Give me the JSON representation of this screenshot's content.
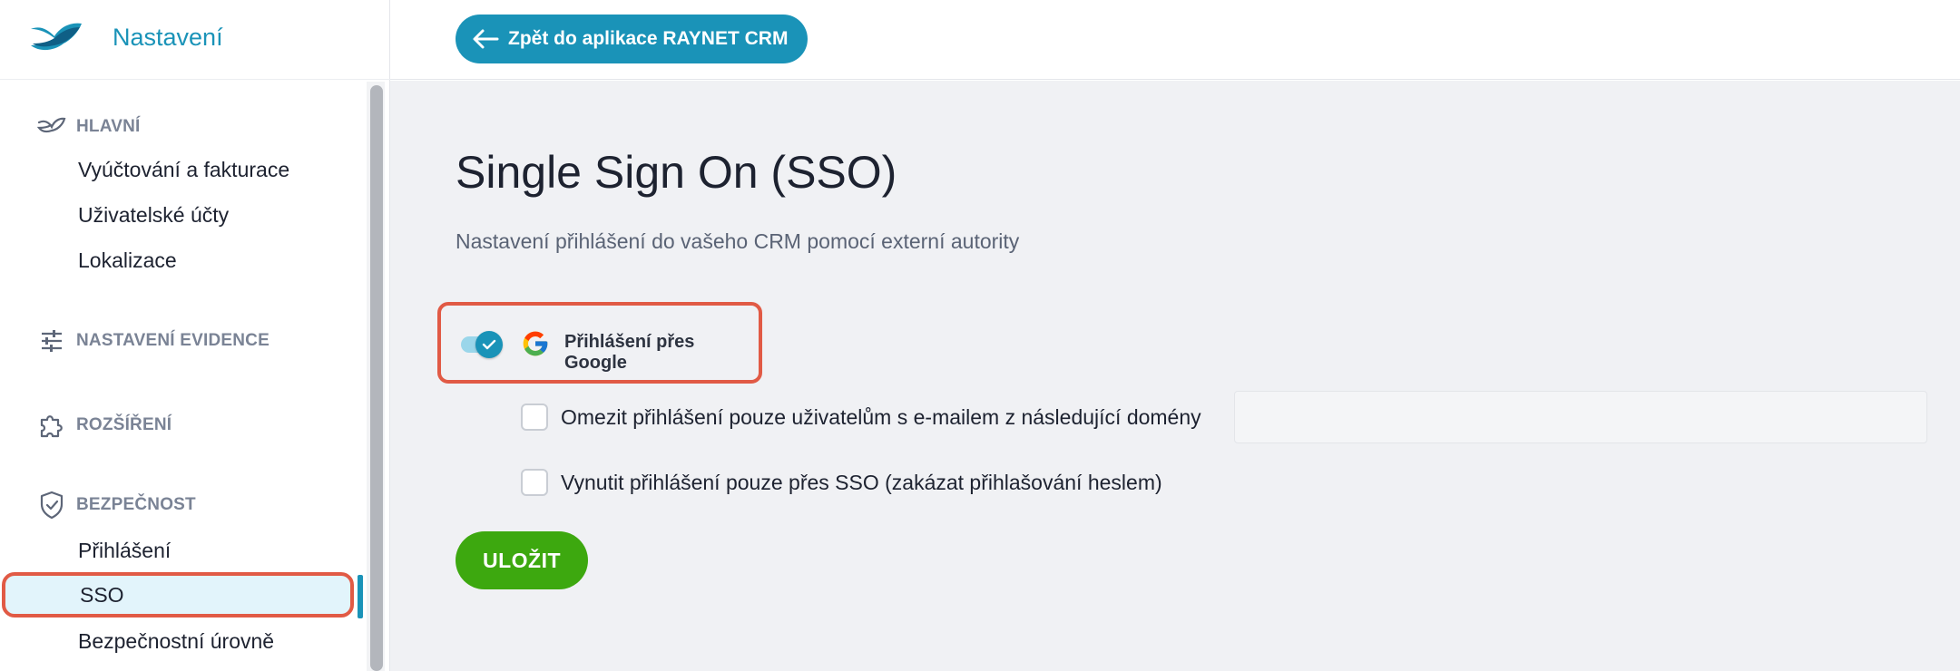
{
  "app": {
    "title": "Nastavení"
  },
  "topbar": {
    "back_label": "Zpět do aplikace RAYNET CRM"
  },
  "sidebar": {
    "sections": [
      {
        "label": "HLAVNÍ",
        "icon": "raynet-logo-icon",
        "items": [
          "Vyúčtování a fakturace",
          "Uživatelské účty",
          "Lokalizace"
        ]
      },
      {
        "label": "NASTAVENÍ EVIDENCE",
        "icon": "sliders-icon",
        "items": []
      },
      {
        "label": "ROZŠÍŘENÍ",
        "icon": "puzzle-icon",
        "items": []
      },
      {
        "label": "BEZPEČNOST",
        "icon": "shield-check-icon",
        "items": [
          "Přihlášení",
          "SSO",
          "Bezpečnostní úrovně"
        ]
      }
    ],
    "active_item": "SSO"
  },
  "main": {
    "title": "Single Sign On (SSO)",
    "subtitle": "Nastavení přihlášení do vašeho CRM pomocí externí autority",
    "google_toggle": {
      "label": "Přihlášení přes Google",
      "enabled": true,
      "icon": "google-icon"
    },
    "options": [
      {
        "label": "Omezit přihlášení pouze uživatelům s e-mailem z následující domény",
        "checked": false
      },
      {
        "label": "Vynutit přihlášení pouze přes SSO (zakázat přihlašování heslem)",
        "checked": false
      }
    ],
    "domain_input": {
      "value": "",
      "placeholder": ""
    },
    "save_label": "ULOŽIT"
  },
  "colors": {
    "accent": "#1a93b8",
    "save": "#3da80f",
    "highlight": "#e15a45",
    "active_bg": "#e2f4fb"
  }
}
